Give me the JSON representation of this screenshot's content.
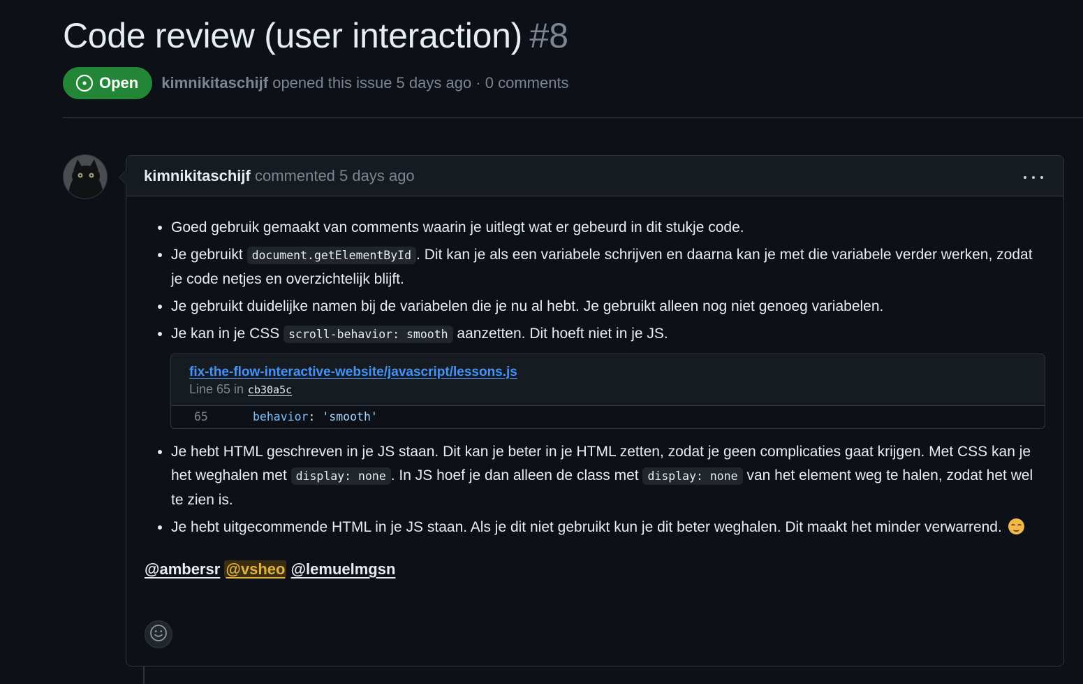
{
  "issue": {
    "title": "Code review (user interaction)",
    "number": "#8",
    "state": "Open",
    "author": "kimnikitaschijf",
    "meta": "opened this issue 5 days ago · 0 comments"
  },
  "comment": {
    "author": "kimnikitaschijf",
    "action": "commented 5 days ago",
    "items": [
      {
        "text": "Goed gebruik gemaakt van comments waarin je uitlegt wat er gebeurd in dit stukje code."
      },
      {
        "before": "Je gebruikt ",
        "code": "document.getElementById",
        "after": ". Dit kan je als een variabele schrijven en daarna kan je met die variabele verder werken, zodat je code netjes en overzichtelijk blijft."
      },
      {
        "text": "Je gebruikt duidelijke namen bij de variabelen die je nu al hebt. Je gebruikt alleen nog niet genoeg variabelen."
      },
      {
        "before": "Je kan in je CSS ",
        "code": "scroll-behavior: smooth",
        "after": " aanzetten. Dit hoeft niet in je JS."
      },
      {
        "before": "Je hebt HTML geschreven in je JS staan. Dit kan je beter in je HTML zetten, zodat je geen complicaties gaat krijgen. Met CSS kan je het weghalen met ",
        "code": "display: none",
        "middle": ". In JS hoef je dan alleen de class met ",
        "code2": "display: none",
        "after": " van het element weg te halen, zodat het wel te zien is."
      },
      {
        "text": "Je hebt uitgecommende HTML in je JS staan. Als je dit niet gebruikt kun je dit beter weghalen. Dit maakt het minder verwarrend."
      }
    ],
    "permalink": {
      "path": "fix-the-flow-interactive-website/javascript/lessons.js",
      "line_label": "Line 65 in",
      "sha": "cb30a5c",
      "line_number": "65",
      "code_prop": "behavior",
      "code_colon": ": ",
      "code_value": "'smooth'"
    },
    "mentions": [
      "@ambersr",
      "@vsheo",
      "@lemuelmgsn"
    ]
  },
  "icons": {
    "state": "issue-opened-icon",
    "more": "kebab-horizontal-icon",
    "reaction": "smiley-icon",
    "emoji": "relieved-face-emoji"
  },
  "colors": {
    "background": "#0d1117",
    "open_badge": "#238636",
    "link": "#4493f8",
    "mention_highlight": "#e3b341"
  }
}
